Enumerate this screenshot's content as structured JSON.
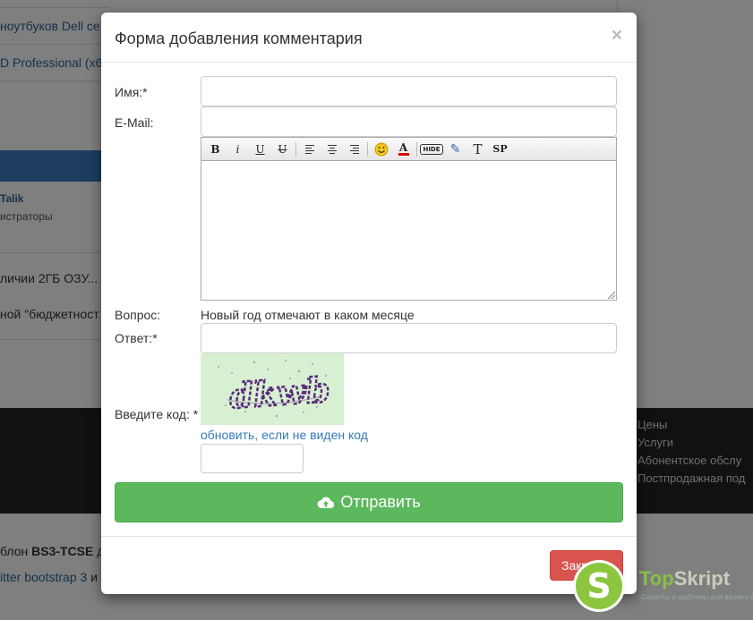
{
  "background": {
    "links": [
      "ноутбуков Dell се",
      "D Professional (x6"
    ],
    "author": "Talik",
    "role": "истраторы",
    "text_lines": [
      "личии 2ГБ ОЗУ... I",
      "ной \"бюджетност"
    ],
    "footer_links": [
      "Цены",
      "Услуги",
      "Абонентское обслу",
      "Постпродажная под"
    ],
    "bottom_line1_prefix": "блон ",
    "bottom_line1_bold": "BS3-TCSE",
    "bottom_line1_suffix": " д",
    "bottom_line2_link": "itter bootstrap 3",
    "bottom_line2_suffix": " и"
  },
  "modal": {
    "title": "Форма добавления комментария",
    "close_symbol": "×",
    "name_label": "Имя:*",
    "email_label": "E-Mail:",
    "question_label": "Вопрос:",
    "question_text": "Новый год отмечают в каком месяце",
    "answer_label": "Ответ:*",
    "code_label": "Введите код: *",
    "captcha_text": "dkwb",
    "refresh_link": "обновить, если не виден код",
    "submit_label": "Отправить",
    "close_button_label": "Закрыть"
  },
  "editor_toolbar": [
    {
      "name": "bold-button",
      "glyph": "B"
    },
    {
      "name": "italic-button",
      "glyph": "i"
    },
    {
      "name": "underline-button",
      "glyph": "U"
    },
    {
      "name": "strike-button",
      "glyph": "U"
    },
    {
      "name": "align-left-button",
      "glyph": ""
    },
    {
      "name": "align-center-button",
      "glyph": ""
    },
    {
      "name": "align-right-button",
      "glyph": ""
    },
    {
      "name": "smiley-button",
      "glyph": "☺"
    },
    {
      "name": "text-color-button",
      "glyph": "A"
    },
    {
      "name": "hide-button",
      "glyph": "HIDE"
    },
    {
      "name": "edit-button",
      "glyph": "✎"
    },
    {
      "name": "font-button",
      "glyph": "T"
    },
    {
      "name": "spoiler-button",
      "glyph": "SP"
    }
  ],
  "watermark": {
    "logo_letter": "S",
    "brand_part1": "Top",
    "brand_part2": "Skript",
    "tagline": "Скрипты и шаблоны для вашего сайта"
  },
  "colors": {
    "submit": "#5cb85c",
    "close": "#d9534f",
    "link": "#337ab7",
    "footer_bg": "#222222",
    "watermark_green": "#8cc63f"
  },
  "icons": {
    "close": "close-icon",
    "submit": "cloud-upload-icon",
    "smiley": "smiley-icon"
  }
}
